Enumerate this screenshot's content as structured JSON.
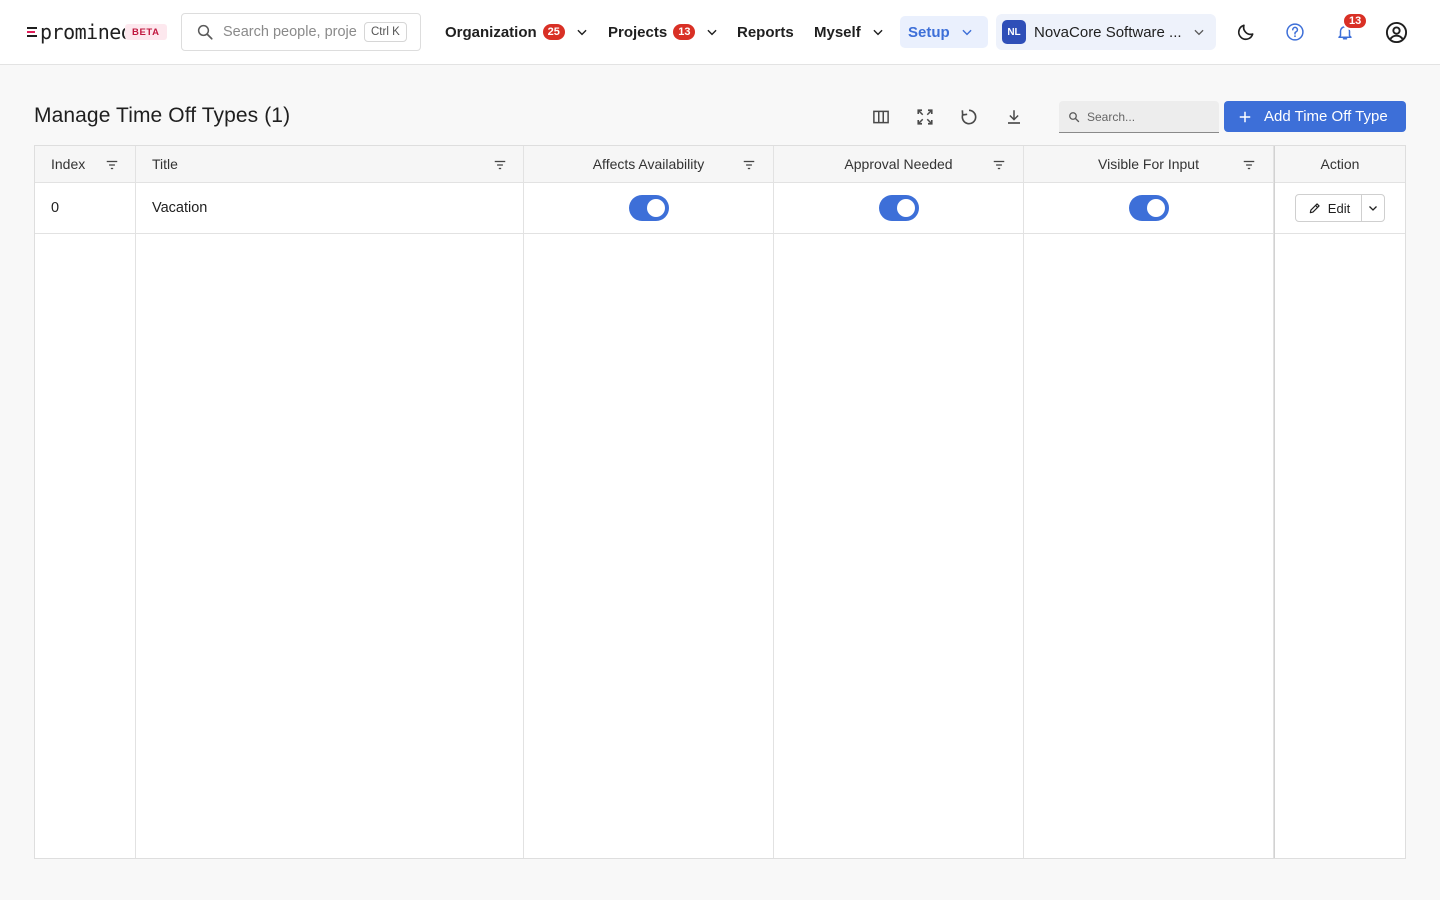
{
  "app": {
    "logo_text": "promineo",
    "beta_label": "BETA"
  },
  "search": {
    "placeholder": "Search people, projects",
    "shortcut": "Ctrl K"
  },
  "nav": {
    "organization": {
      "label": "Organization",
      "badge": "25"
    },
    "projects": {
      "label": "Projects",
      "badge": "13"
    },
    "reports": {
      "label": "Reports"
    },
    "myself": {
      "label": "Myself"
    },
    "setup": {
      "label": "Setup",
      "active": true
    }
  },
  "org_switcher": {
    "initials": "NL",
    "name": "NovaCore Software ..."
  },
  "notifications": {
    "count": "13"
  },
  "colors": {
    "accent": "#3d6fd8",
    "badge": "#d93025",
    "beta_text": "#c0183f"
  },
  "page": {
    "title": "Manage Time Off Types (1)",
    "grid_search_placeholder": "Search...",
    "add_button_label": "Add Time Off Type"
  },
  "table": {
    "columns": {
      "index": "Index",
      "title": "Title",
      "affects_availability": "Affects Availability",
      "approval_needed": "Approval Needed",
      "visible_for_input": "Visible For Input",
      "action": "Action"
    },
    "rows": [
      {
        "index": "0",
        "title": "Vacation",
        "affects_availability": true,
        "approval_needed": true,
        "visible_for_input": true,
        "action_label": "Edit"
      }
    ]
  },
  "icons": {
    "search": "search-icon",
    "chevron": "chevron-down-icon",
    "theme": "moon-icon",
    "help": "help-circle-icon",
    "notifications": "bell-icon",
    "account": "account-circle-icon",
    "columns": "columns-icon",
    "fullscreen": "fullscreen-icon",
    "refresh": "refresh-icon",
    "download": "download-icon",
    "filter": "filter-icon",
    "add": "plus-icon",
    "edit": "pencil-icon"
  }
}
